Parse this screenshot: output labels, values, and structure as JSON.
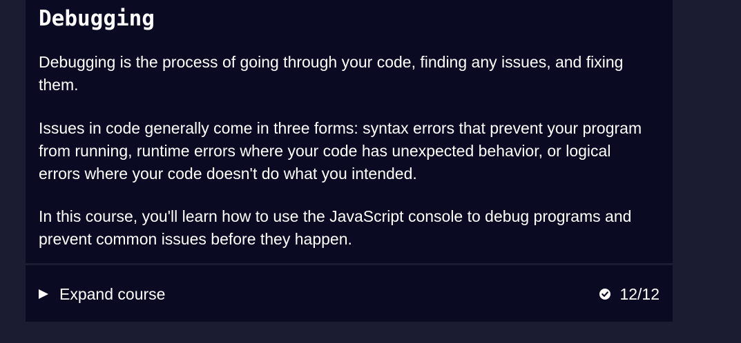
{
  "course": {
    "title": "Debugging",
    "paragraphs": [
      "Debugging is the process of going through your code, finding any issues, and fixing them.",
      "Issues in code generally come in three forms: syntax errors that prevent your program from running, runtime errors where your code has unexpected behavior, or logical errors where your code doesn't do what you intended.",
      "In this course, you'll learn how to use the JavaScript console to debug programs and prevent common issues before they happen."
    ]
  },
  "footer": {
    "expand_label": "Expand course",
    "expand_icon": "triangle-right-icon",
    "progress_icon": "check-circle-icon",
    "progress_text": "12/12"
  },
  "colors": {
    "page_background": "#1b1b32",
    "card_background": "#0a0a23",
    "text": "#ffffff"
  }
}
